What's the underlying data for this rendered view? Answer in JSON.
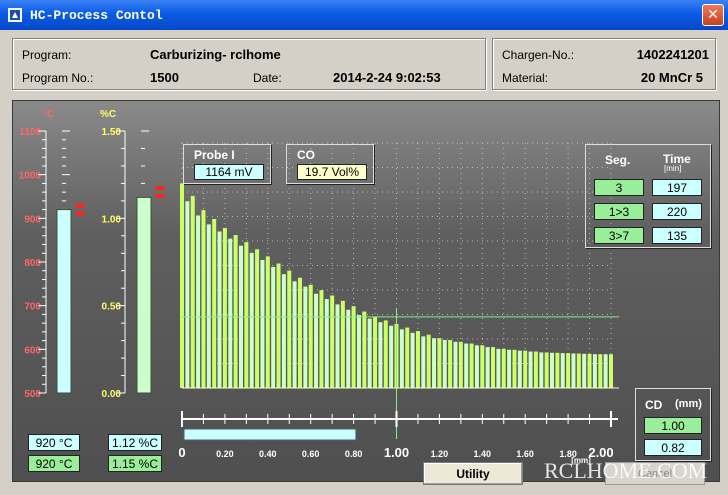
{
  "window": {
    "title": "HC-Process Contol",
    "close_glyph": "✕"
  },
  "program_info": {
    "program_label": "Program:",
    "program_value": "Carburizing- rclhome",
    "program_no_label": "Program No.:",
    "program_no_value": "1500",
    "date_label": "Date:",
    "date_value": "2014-2-24 9:02:53"
  },
  "charge_info": {
    "charge_label": "Chargen-No.:",
    "charge_value": "1402241201",
    "material_label": "Material:",
    "material_value": "20 MnCr 5"
  },
  "temp_gauge": {
    "unit": "°C",
    "ticks": [
      "1100",
      "1000",
      "900",
      "800",
      "700",
      "600",
      "500"
    ],
    "bar_value": 920,
    "set_value": 920,
    "range": [
      500,
      1100
    ],
    "actual_label": "920 °C",
    "setpoint_label": "920 °C",
    "bar_color": "#ccffff"
  },
  "carbon_gauge": {
    "unit": "%C",
    "ticks": [
      "1.50",
      "1.00",
      "0.50",
      "0.00"
    ],
    "bar_value": 1.12,
    "set_value": 1.15,
    "range": [
      0,
      1.5
    ],
    "actual_label": "1.12 %C",
    "setpoint_label": "1.15 %C",
    "bar_color": "#ccffcc"
  },
  "probe": {
    "label": "Probe I",
    "value": "1164 mV"
  },
  "co": {
    "label": "CO",
    "value": "19.7 Vol%"
  },
  "segments": {
    "seg_header": "Seg.",
    "time_header": "Time",
    "time_unit": "[min]",
    "rows": [
      {
        "seg": "3",
        "time": "197"
      },
      {
        "seg": "1>3",
        "time": "220"
      },
      {
        "seg": "3>7",
        "time": "135"
      }
    ]
  },
  "cd": {
    "label": "CD",
    "unit": "(mm)",
    "values": [
      "1.00",
      "0.82"
    ]
  },
  "chart_data": {
    "type": "bar",
    "xlabel": "[mm]",
    "xlim": [
      0,
      2.0
    ],
    "ylim": [
      0,
      1.5
    ],
    "tick_labels": [
      "0",
      "0.20",
      "0.40",
      "0.60",
      "0.80",
      "1.00",
      "1.20",
      "1.40",
      "1.60",
      "1.80",
      "2.00"
    ],
    "reference_depth": 1.0,
    "reference_level": 0.4,
    "progress_depth": 0.82,
    "series": [
      {
        "color": "#ccff66",
        "x": [
          0.0,
          0.05,
          0.1,
          0.15,
          0.2,
          0.25,
          0.3,
          0.35,
          0.4,
          0.45,
          0.5,
          0.55,
          0.6,
          0.65,
          0.7,
          0.75,
          0.8,
          0.85,
          0.9,
          0.95,
          1.0,
          1.05,
          1.1,
          1.15,
          1.2,
          1.25,
          1.3,
          1.35,
          1.4,
          1.45,
          1.5,
          1.55,
          1.6,
          1.65,
          1.7,
          1.75,
          1.8,
          1.85,
          1.9,
          1.95,
          2.0
        ],
        "values": [
          1.15,
          1.08,
          1.0,
          0.95,
          0.9,
          0.86,
          0.82,
          0.78,
          0.74,
          0.7,
          0.66,
          0.62,
          0.58,
          0.55,
          0.52,
          0.49,
          0.46,
          0.43,
          0.4,
          0.38,
          0.36,
          0.34,
          0.32,
          0.3,
          0.28,
          0.27,
          0.26,
          0.25,
          0.24,
          0.23,
          0.22,
          0.215,
          0.21,
          0.205,
          0.2,
          0.198,
          0.196,
          0.194,
          0.192,
          0.19,
          0.19
        ]
      },
      {
        "color": "#ccffcc",
        "x": [
          0.025,
          0.075,
          0.125,
          0.175,
          0.225,
          0.275,
          0.325,
          0.375,
          0.425,
          0.475,
          0.525,
          0.575,
          0.625,
          0.675,
          0.725,
          0.775,
          0.825,
          0.875,
          0.925,
          0.975,
          1.025,
          1.075,
          1.125,
          1.175,
          1.225,
          1.275,
          1.325,
          1.375,
          1.425,
          1.475,
          1.525,
          1.575,
          1.625,
          1.675,
          1.725,
          1.775,
          1.825,
          1.875,
          1.925,
          1.975
        ],
        "values": [
          1.05,
          0.97,
          0.92,
          0.88,
          0.84,
          0.8,
          0.76,
          0.72,
          0.68,
          0.64,
          0.6,
          0.57,
          0.53,
          0.5,
          0.47,
          0.44,
          0.41,
          0.39,
          0.37,
          0.35,
          0.33,
          0.31,
          0.29,
          0.28,
          0.27,
          0.26,
          0.25,
          0.24,
          0.23,
          0.22,
          0.215,
          0.21,
          0.205,
          0.2,
          0.198,
          0.196,
          0.194,
          0.192,
          0.19,
          0.19
        ]
      }
    ]
  },
  "buttons": {
    "utility": "Utility",
    "cancel": "Cancel"
  },
  "watermark": "RCLHOME.COM"
}
